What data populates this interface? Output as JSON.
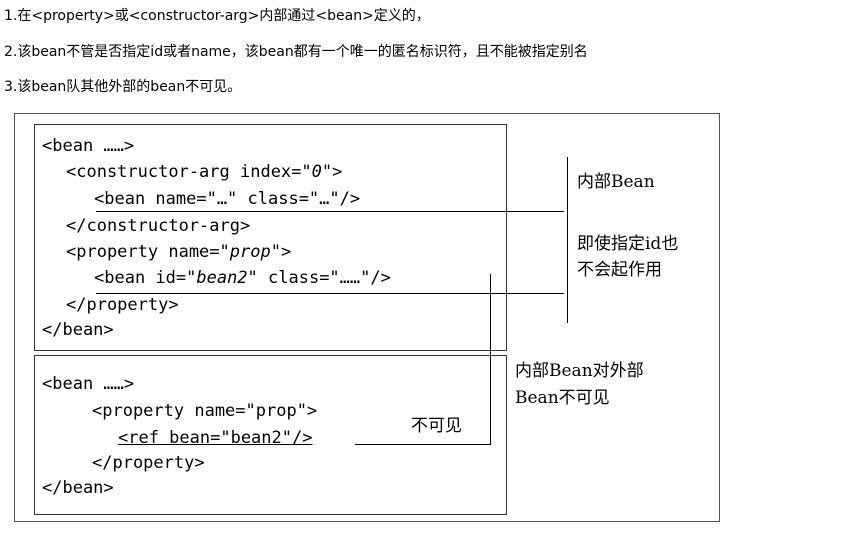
{
  "notes": {
    "n1": "1.在<property>或<constructor-arg>内部通过<bean>定义的，",
    "n2": "2.该bean不管是否指定id或者name，该bean都有一个唯一的匿名标识符，且不能被指定别名",
    "n3": "3.该bean队其他外部的bean不可见。"
  },
  "box1": {
    "l1": "<bean ……>",
    "l2a": "<constructor-arg index=",
    "l2v": "\"0\"",
    "l2b": ">",
    "l3": "<bean name=\"…\" class=\"…\"/>",
    "l4": "</constructor-arg>",
    "l5a": "<property name=",
    "l5v": "\"prop\"",
    "l5b": ">",
    "l6a": "<bean id=",
    "l6v": "\"bean2\"",
    "l6b": " class=\"……\"/>",
    "l7": "</property>",
    "l8": "</bean>"
  },
  "box2": {
    "l1": "<bean ……>",
    "l2": "<property name=\"prop\">",
    "l3": "<ref bean=\"bean2\"/>",
    "l4": "</property>",
    "l5": "</bean>"
  },
  "labels": {
    "inner_bean": "内部Bean",
    "id_no_effect_1": "即使指定id也",
    "id_no_effect_2": "不会起作用",
    "invisible": "不可见",
    "inner_outside_1": "内部Bean对外部",
    "inner_outside_2": "Bean不可见"
  }
}
